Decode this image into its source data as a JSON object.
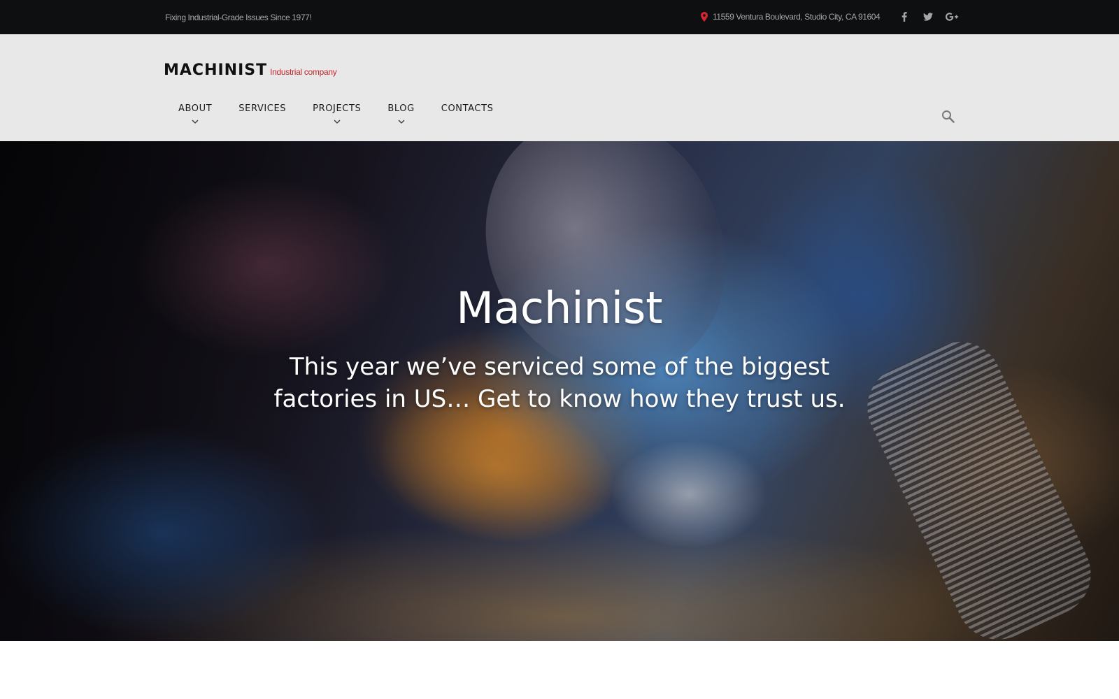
{
  "topbar": {
    "tagline": "Fixing Industrial-Grade Issues Since 1977!",
    "address": "11559 Ventura Boulevard, Studio City, CA 91604",
    "address_icon": "map-pin-icon",
    "socials": [
      {
        "icon": "facebook-icon",
        "glyph": "f"
      },
      {
        "icon": "twitter-icon",
        "glyph": "t"
      },
      {
        "icon": "google-plus-icon",
        "glyph": "G+"
      }
    ]
  },
  "header": {
    "logo_name": "MACHINIST",
    "logo_subtitle": "Industrial company",
    "nav": [
      {
        "label": "ABOUT",
        "has_dropdown": true
      },
      {
        "label": "SERVICES",
        "has_dropdown": false
      },
      {
        "label": "PROJECTS",
        "has_dropdown": true
      },
      {
        "label": "BLOG",
        "has_dropdown": true
      },
      {
        "label": "CONTACTS",
        "has_dropdown": false
      }
    ],
    "search_icon": "search-icon"
  },
  "hero": {
    "title": "Machinist",
    "subtitle": "This year we’ve serviced some of the biggest factories in US… Get to know how they trust us."
  },
  "colors": {
    "topbar_bg": "#0e0f10",
    "header_bg": "#e8e8e8",
    "accent_red": "#c2262c",
    "text_dark": "#1a1a1a",
    "muted_text": "#a7a7a7"
  }
}
